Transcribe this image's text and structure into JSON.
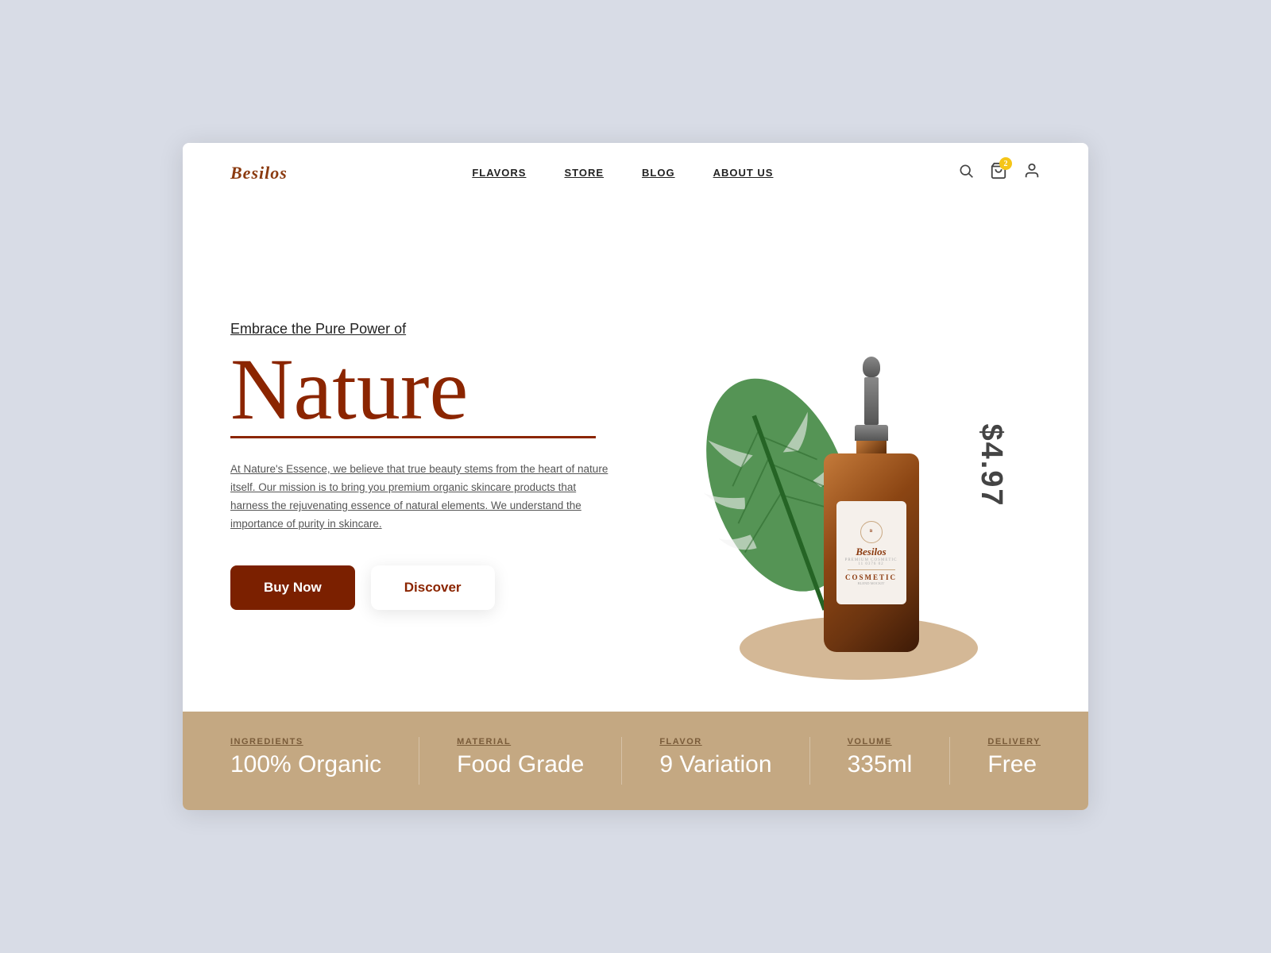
{
  "brand": {
    "name": "Besilos"
  },
  "navbar": {
    "links": [
      {
        "id": "flavors",
        "label": "FLAVORS"
      },
      {
        "id": "store",
        "label": "STORE"
      },
      {
        "id": "blog",
        "label": "BLOG"
      },
      {
        "id": "about",
        "label": "ABOUT US"
      }
    ],
    "cart_count": "2"
  },
  "hero": {
    "tagline": "Embrace the Pure Power of",
    "title": "Nature",
    "description": "At Nature's Essence, we believe that true beauty stems from the heart of nature itself. Our mission is to bring you premium organic skincare products that harness the rejuvenating essence of natural elements. We understand the importance of purity in skincare.",
    "btn_buy": "Buy Now",
    "btn_discover": "Discover",
    "price": "$4.97"
  },
  "bottle": {
    "brand": "Besilos",
    "brand_sub": "PREMIUM COSMETIC",
    "sku": "11 0376 02",
    "type": "COSMETIC",
    "type_sub": "BLEND MOCKIT"
  },
  "stats": [
    {
      "id": "ingredients",
      "label": "INGREDIENTS",
      "value": "100% Organic"
    },
    {
      "id": "material",
      "label": "MATERIAL",
      "value": "Food Grade"
    },
    {
      "id": "flavor",
      "label": "FLAVOR",
      "value": "9 Variation"
    },
    {
      "id": "volume",
      "label": "VOLUME",
      "value": "335ml"
    },
    {
      "id": "delivery",
      "label": "DELIVERY",
      "value": "Free"
    }
  ]
}
